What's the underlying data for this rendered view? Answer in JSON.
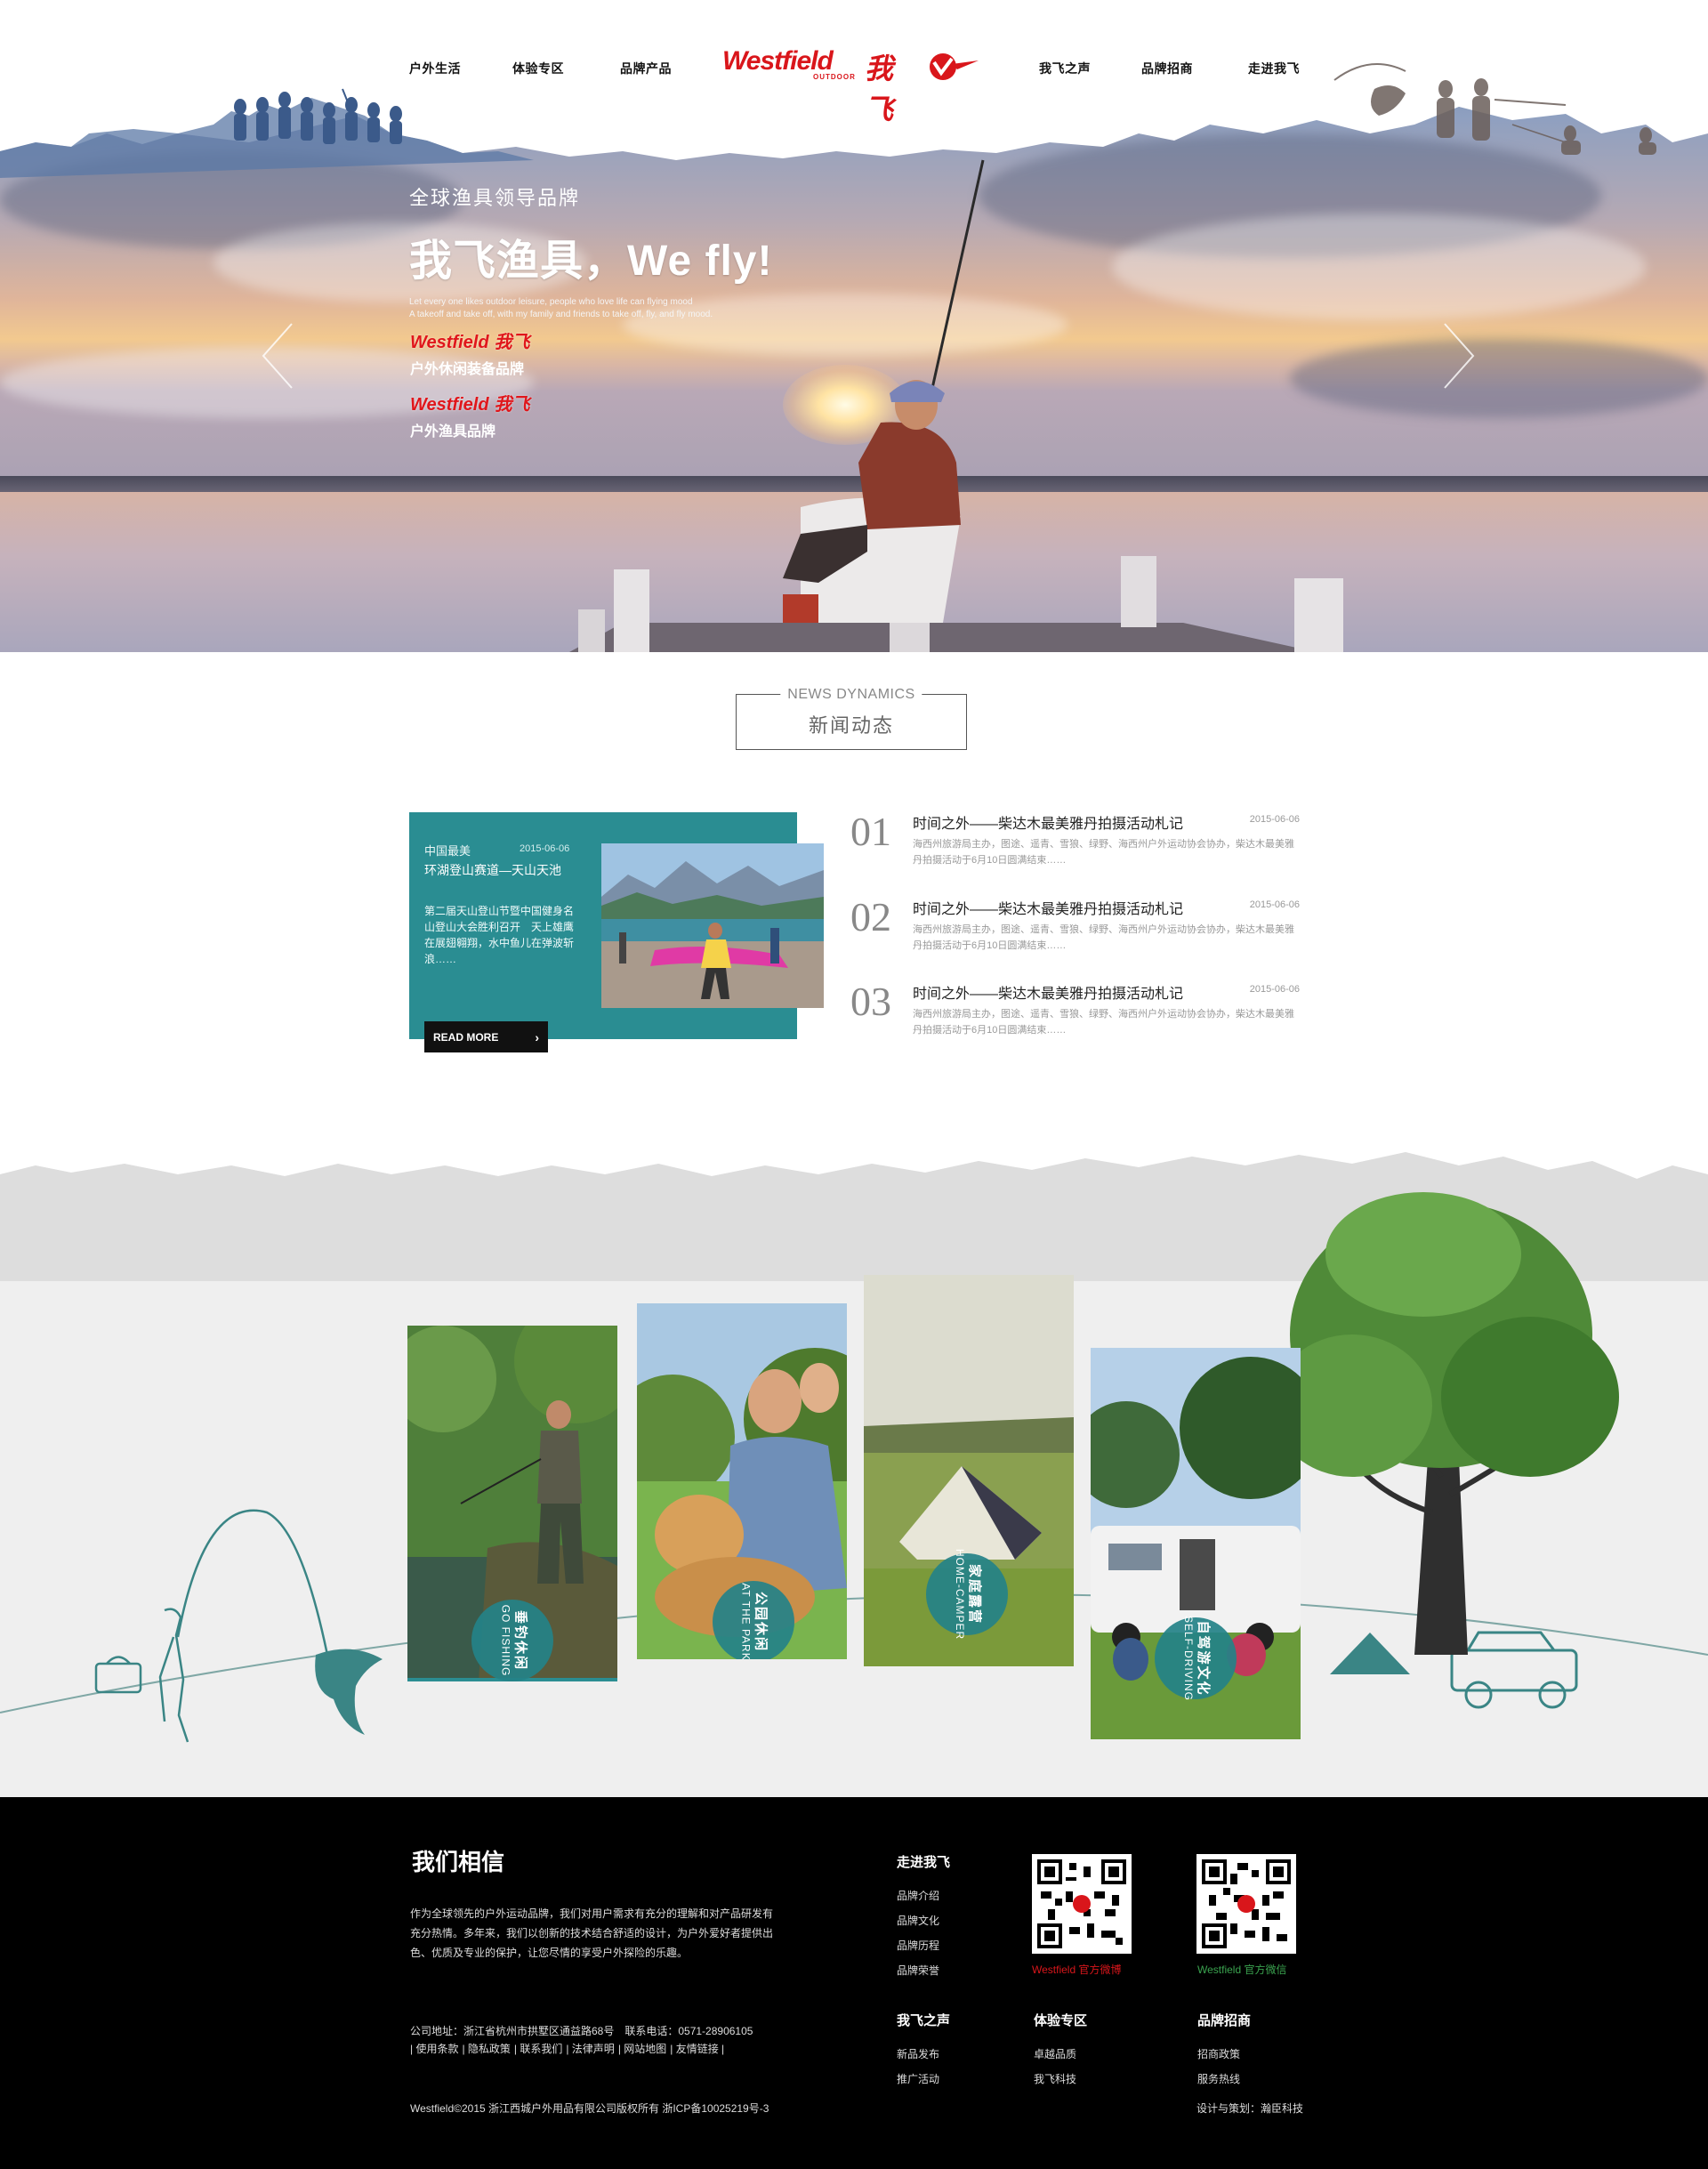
{
  "nav": {
    "left": [
      "户外生活",
      "体验专区",
      "品牌产品"
    ],
    "right": [
      "我飞之声",
      "品牌招商",
      "走进我飞"
    ],
    "logo": {
      "en": "Westfield",
      "sub": "OUTDOOR",
      "cn": "我飞"
    }
  },
  "hero": {
    "tagline": "全球渔具领导品牌",
    "headline": "我飞渔具，We fly!",
    "en_line1": "Let every one likes outdoor leisure, people who love life can flying mood",
    "en_line2": "A takeoff and take off, with my family and friends to take off, fly, and fly mood.",
    "brand1_logo": "Westfield",
    "brand1_cn": "我飞",
    "brand1_label": "户外休闲装备品牌",
    "brand2_logo": "Westfield",
    "brand2_cn": "我飞",
    "brand2_label": "户外渔具品牌",
    "prev_icon": "chevron-left-icon",
    "next_icon": "chevron-right-icon"
  },
  "news": {
    "title_en": "NEWS DYNAMICS",
    "title_cn": "新闻动态",
    "featured": {
      "tag": "中国最美",
      "date": "2015-06-06",
      "title": "环湖登山赛道—天山天池",
      "desc": "第二届天山登山节暨中国健身名山登山大会胜利召开　天上雄鹰在展翅翱翔，水中鱼儿在弹波斩浪……",
      "read_more": "READ MORE"
    },
    "items": [
      {
        "num": "01",
        "title": "时间之外——柴达木最美雅丹拍摄活动札记",
        "date": "2015-06-06",
        "desc": "海西州旅游局主办，图途、遥青、雪狼、绿野、海西州户外运动协会协办，柴达木最美雅丹拍摄活动于6月10日圆满结束……"
      },
      {
        "num": "02",
        "title": "时间之外——柴达木最美雅丹拍摄活动札记",
        "date": "2015-06-06",
        "desc": "海西州旅游局主办，图途、遥青、雪狼、绿野、海西州户外运动协会协办，柴达木最美雅丹拍摄活动于6月10日圆满结束……"
      },
      {
        "num": "03",
        "title": "时间之外——柴达木最美雅丹拍摄活动札记",
        "date": "2015-06-06",
        "desc": "海西州旅游局主办，图途、遥青、雪狼、绿野、海西州户外运动协会协办，柴达木最美雅丹拍摄活动于6月10日圆满结束……"
      }
    ]
  },
  "activities": [
    {
      "cn": "垂钓休闲",
      "en": "GO FISHING"
    },
    {
      "cn": "公园休闲",
      "en": "AT THE PARK"
    },
    {
      "cn": "家庭露营",
      "en": "HOME-CAMPER"
    },
    {
      "cn": "自驾游文化",
      "en": "SELF-DRIVING"
    }
  ],
  "footer": {
    "title": "我们相信",
    "about": "作为全球领先的户外运动品牌，我们对用户需求有充分的理解和对产品研发有充分热情。多年来，我们以创新的技术结合舒适的设计，为户外爱好者提供出色、优质及专业的保护，让您尽情的享受户外探险的乐趣。",
    "address": "公司地址：浙江省杭州市拱墅区通益路68号　联系电话：0571-28906105",
    "links": [
      "| 使用条款",
      "| 隐私政策",
      "| 联系我们",
      "| 法律声明",
      "| 网站地图",
      "| 友情链接 |"
    ],
    "copyright": "Westfield©2015 浙江西城户外用品有限公司版权所有 浙ICP备10025219号-3",
    "credit": "设计与策划：瀚臣科技",
    "col1": {
      "title": "走进我飞",
      "items": [
        "品牌介绍",
        "品牌文化",
        "品牌历程",
        "品牌荣誉"
      ]
    },
    "col2": {
      "title": "我飞之声",
      "items": [
        "新品发布",
        "推广活动"
      ]
    },
    "col3": {
      "title": "体验专区",
      "items": [
        "卓越品质",
        "我飞科技"
      ]
    },
    "col4": {
      "title": "品牌招商",
      "items": [
        "招商政策",
        "服务热线"
      ]
    },
    "qr1": {
      "brand": "Westfield",
      "label": "官方微博",
      "color": "#d9161b"
    },
    "qr2": {
      "brand": "Westfield",
      "label": "官方微信",
      "color": "#3aa34f"
    }
  }
}
